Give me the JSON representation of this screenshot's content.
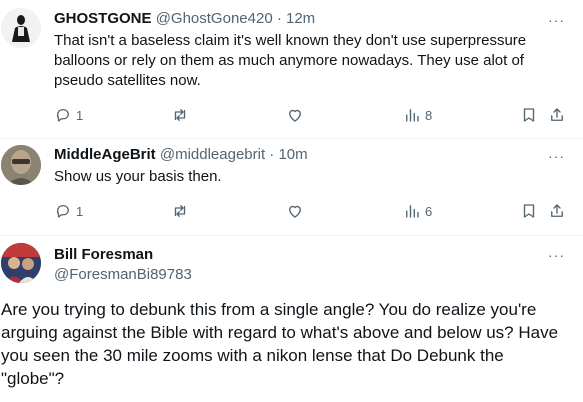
{
  "replies": [
    {
      "name": "GHOSTGONE",
      "handle": "@GhostGone420",
      "time": "12m",
      "text": "That isn't a baseless claim it's well known they don't use superpressure balloons or rely on them as much anymore nowadays. They use alot of pseudo satellites now.",
      "replies_count": "1",
      "views": "8"
    },
    {
      "name": "MiddleAgeBrit",
      "handle": "@middleagebrit",
      "time": "10m",
      "text": "Show us your basis then.",
      "replies_count": "1",
      "views": "6"
    }
  ],
  "main_post": {
    "name": "Bill Foresman",
    "handle": "@ForesmanBi89783",
    "text": "Are you trying to debunk this from a single angle? You do realize you're arguing against the Bible with regard to what's above and below us? Have you seen the 30 mile zooms with a nikon lense that Do Debunk the \"globe\"?"
  },
  "separator_dot": "·",
  "more_glyph": "···",
  "colors": {
    "text": "#0f1419",
    "secondary": "#536471",
    "border": "#eff3f4"
  },
  "icons": [
    "reply-icon",
    "retweet-icon",
    "like-icon",
    "views-icon",
    "bookmark-icon",
    "share-icon",
    "more-icon"
  ]
}
